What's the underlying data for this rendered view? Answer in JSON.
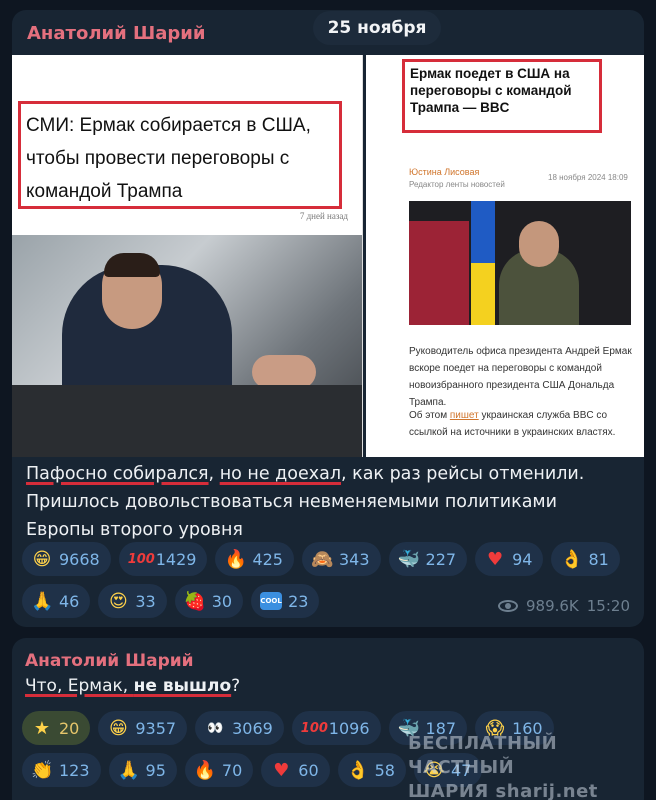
{
  "date_pill": "25 ноября",
  "post1": {
    "author": "Анатолий Шарий",
    "left_shot": {
      "headline": "СМИ: Ермак собирается в США, чтобы провести переговоры с командой Трампа",
      "meta": "7 дней назад"
    },
    "right_shot": {
      "headline": "Ермак поедет в США на переговоры с командой Трампа — BBC",
      "author": "Юстина Лисовая",
      "role": "Редактор ленты новостей",
      "date": "18 ноября 2024 18:09",
      "paragraph": "Руководитель офиса президента Андрей Ермак вскоре поедет на переговоры с командой новоизбранного президента США Дональда Трампа.",
      "para2_before": "Об этом ",
      "para2_link": "пишет",
      "para2_after": " украинская служба BBC со ссылкой на источники в украинских властях."
    },
    "text_u1": "Пафосно собирался",
    "text_mid": ", ",
    "text_u2": "но не доехал",
    "text_rest": ", как раз рейсы отменили. Пришлось довольствоваться невменяемыми политиками Европы второго уровня",
    "reactions": [
      {
        "emoji": "grin-icon",
        "glyph": "😁",
        "count": "9668"
      },
      {
        "emoji": "hundred-icon",
        "glyph": "100",
        "count": "1429"
      },
      {
        "emoji": "fire-icon",
        "glyph": "🔥",
        "count": "425"
      },
      {
        "emoji": "see-no-evil-icon",
        "glyph": "🙈",
        "count": "343"
      },
      {
        "emoji": "whale-icon",
        "glyph": "🐳",
        "count": "227"
      },
      {
        "emoji": "heart-icon",
        "glyph": "♥",
        "count": "94"
      },
      {
        "emoji": "ok-hand-icon",
        "glyph": "👌",
        "count": "81"
      },
      {
        "emoji": "pray-icon",
        "glyph": "🙏",
        "count": "46"
      },
      {
        "emoji": "heart-eyes-icon",
        "glyph": "😍",
        "count": "33"
      },
      {
        "emoji": "strawberry-icon",
        "glyph": "🍓",
        "count": "30"
      },
      {
        "emoji": "cool-icon",
        "glyph": "COOL",
        "count": "23"
      }
    ],
    "views": "989.6K",
    "time": "15:20"
  },
  "post2": {
    "author": "Анатолий Шарий",
    "text_a": "Что, Ермак, ",
    "text_b": "не вышло",
    "text_c": "?",
    "reactions": [
      {
        "emoji": "star-icon",
        "glyph": "★",
        "count": "20",
        "selected": true
      },
      {
        "emoji": "grin-icon",
        "glyph": "😁",
        "count": "9357"
      },
      {
        "emoji": "eyes-icon",
        "glyph": "👀",
        "count": "3069"
      },
      {
        "emoji": "hundred-icon",
        "glyph": "100",
        "count": "1096"
      },
      {
        "emoji": "whale-icon",
        "glyph": "🐳",
        "count": "187"
      },
      {
        "emoji": "scream-icon",
        "glyph": "😱",
        "count": "160"
      },
      {
        "emoji": "clap-icon",
        "glyph": "👏",
        "count": "123"
      },
      {
        "emoji": "pray-icon",
        "glyph": "🙏",
        "count": "95"
      },
      {
        "emoji": "fire-icon",
        "glyph": "🔥",
        "count": "70"
      },
      {
        "emoji": "heart-icon",
        "glyph": "♥",
        "count": "60"
      },
      {
        "emoji": "ok-hand-icon",
        "glyph": "👌",
        "count": "58"
      },
      {
        "emoji": "cry-icon",
        "glyph": "😭",
        "count": "47"
      }
    ]
  },
  "watermark": {
    "line1": "БЕСПЛАТНЫЙ ЧАСТНЫЙ",
    "line2": "ШАРИЯ sharij.net"
  }
}
